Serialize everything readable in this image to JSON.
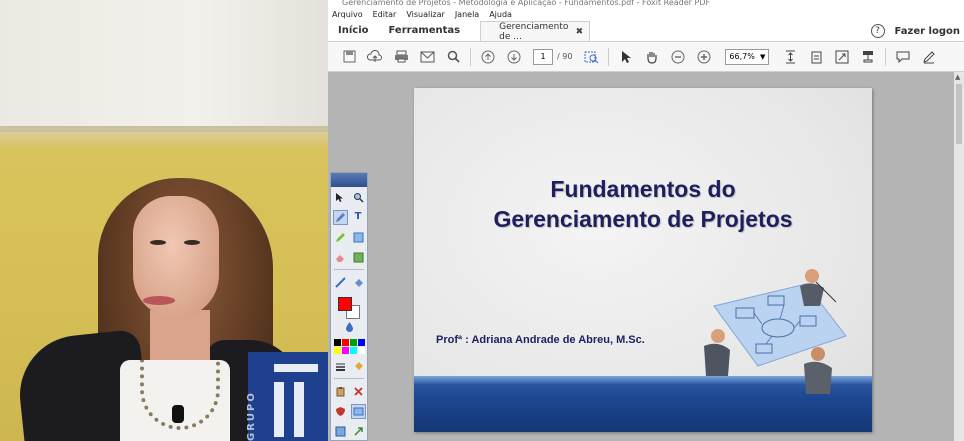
{
  "window": {
    "title": "Gerenciamento de Projetos - Metodologia e Aplicação - Fundamentos.pdf - Foxit Reader PDF"
  },
  "menu": [
    "Arquivo",
    "Editar",
    "Visualizar",
    "Janela",
    "Ajuda"
  ],
  "tabs": {
    "home": "Início",
    "tools": "Ferramentas",
    "document": "Gerenciamento de ...",
    "login": "Fazer logon"
  },
  "toolbar": {
    "current_page": "1",
    "total_pages": "/ 90",
    "zoom": "66,7%"
  },
  "slide": {
    "title_line1": "Fundamentos do",
    "title_line2": "Gerenciamento de Projetos",
    "author": "Profª : Adriana Andrade de Abreu, M.Sc."
  },
  "webcam": {
    "logo_text": "GRUPO"
  },
  "annotation_toolbar": {
    "primary_color": "#ff0000",
    "secondary_color": "#ffffff",
    "palette": [
      "#000000",
      "#ff0000",
      "#00a000",
      "#0000ff",
      "#ffff00",
      "#ff00ff",
      "#00ffff",
      "#ffffff"
    ]
  },
  "colors": {
    "slide_title": "#1e1f5e",
    "slide_band": "#1d4790"
  }
}
